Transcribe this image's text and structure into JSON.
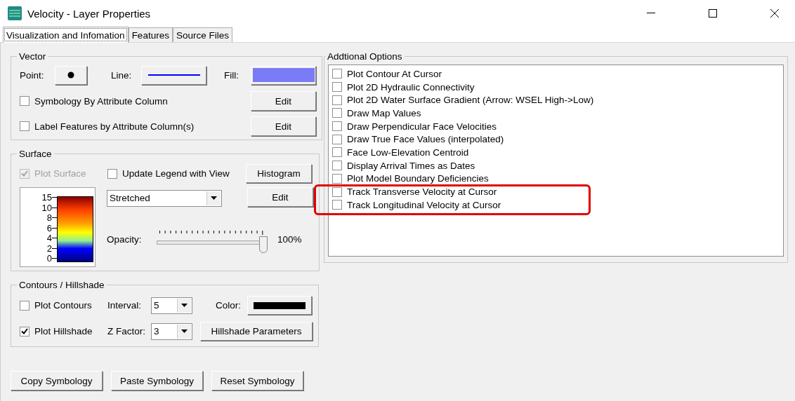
{
  "window": {
    "title": "Velocity - Layer Properties"
  },
  "tabs": [
    {
      "label": "Visualization and Infomation",
      "selected": true
    },
    {
      "label": "Features",
      "selected": false
    },
    {
      "label": "Source Files",
      "selected": false
    }
  ],
  "vector": {
    "title": "Vector",
    "point_label": "Point:",
    "line_label": "Line:",
    "fill_label": "Fill:",
    "options": [
      {
        "label": "Symbology By Attribute Column",
        "checked": false,
        "button": "Edit"
      },
      {
        "label": "Label Features by Attribute Column(s)",
        "checked": false,
        "button": "Edit"
      }
    ]
  },
  "surface": {
    "title": "Surface",
    "plot_surface": {
      "label": "Plot Surface",
      "checked": true,
      "disabled": true
    },
    "update_legend": {
      "label": "Update Legend with View",
      "checked": false
    },
    "histogram_button": "Histogram",
    "legend_ticks": [
      "15",
      "10",
      "8",
      "6",
      "4",
      "2",
      "0"
    ],
    "stretch": "Stretched",
    "edit_button": "Edit",
    "opacity_label": "Opacity:",
    "opacity": {
      "level": 1
    },
    "opacity_reading": "100%"
  },
  "contours": {
    "title": "Contours / Hillshade",
    "plot_contours": {
      "label": "Plot Contours",
      "checked": false
    },
    "interval_label": "Interval:",
    "interval": "5",
    "color_label": "Color:",
    "plot_hillshade": {
      "label": "Plot Hillshade",
      "checked": true
    },
    "zfactor_label": "Z Factor:",
    "zfactor": "3",
    "hillshade_button": "Hillshade Parameters"
  },
  "additional_options": {
    "title": "Addtional Options",
    "items": [
      {
        "label": "Plot Contour At Cursor",
        "checked": false,
        "highlighted": false
      },
      {
        "label": "Plot 2D Hydraulic Connectivity",
        "checked": false,
        "highlighted": false
      },
      {
        "label": "Plot 2D Water Surface Gradient (Arrow: WSEL High->Low)",
        "checked": false,
        "highlighted": false
      },
      {
        "label": "Draw Map Values",
        "checked": false,
        "highlighted": false
      },
      {
        "label": "Draw Perpendicular Face Velocities",
        "checked": false,
        "highlighted": false
      },
      {
        "label": "Draw True Face Values (interpolated)",
        "checked": false,
        "highlighted": false
      },
      {
        "label": "Face Low-Elevation Centroid",
        "checked": false,
        "highlighted": false
      },
      {
        "label": "Display Arrival Times as Dates",
        "checked": false,
        "highlighted": false
      },
      {
        "label": "Plot Model Boundary Deficiencies",
        "checked": false,
        "highlighted": false
      },
      {
        "label": "Track Transverse Velocity at Cursor",
        "checked": false,
        "highlighted": true
      },
      {
        "label": "Track Longitudinal Velocity at Cursor",
        "checked": false,
        "highlighted": true
      }
    ]
  },
  "buttons": [
    "Copy Symbology",
    "Paste Symbology",
    "Reset Symbology"
  ]
}
